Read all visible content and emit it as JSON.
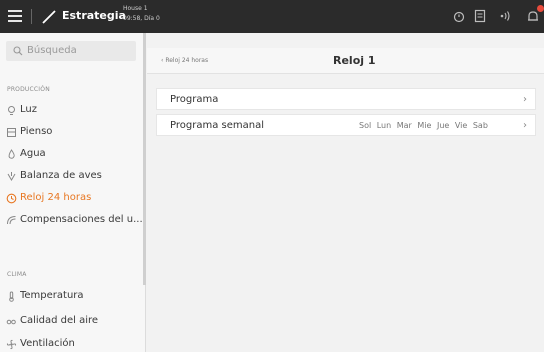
{
  "topbar": {
    "brand": "Estrategia",
    "house_name": "House 1",
    "house_time": "09:58, Día 0",
    "icons": [
      "menu-icon",
      "chart-icon",
      "alarm-icon",
      "document-icon",
      "broadcast-icon",
      "bell-icon"
    ]
  },
  "sidebar": {
    "search_placeholder": "Búsqueda",
    "sections": [
      {
        "label": "PRODUCCIÓN",
        "items": [
          {
            "label": "Luz",
            "icon": "bulb-icon"
          },
          {
            "label": "Pienso",
            "icon": "feed-icon"
          },
          {
            "label": "Agua",
            "icon": "drop-icon"
          },
          {
            "label": "Balanza de aves",
            "icon": "scale-icon"
          },
          {
            "label": "Reloj 24 horas",
            "icon": "clock-icon",
            "active": true
          },
          {
            "label": "Compensaciones del u...",
            "icon": "compensation-icon"
          }
        ]
      },
      {
        "label": "CLIMA",
        "items": [
          {
            "label": "Temperatura",
            "icon": "thermometer-icon"
          },
          {
            "label": "Calidad del aire",
            "icon": "air-icon"
          },
          {
            "label": "Ventilación",
            "icon": "fan-icon"
          }
        ]
      }
    ]
  },
  "main": {
    "back_label": "Reloj 24 horas",
    "title": "Reloj 1",
    "rows": [
      {
        "label": "Programa"
      },
      {
        "label": "Programa semanal",
        "days": "Sol Lun Mar Mie Jue Vie Sab"
      }
    ]
  },
  "colors": {
    "topbar": "#2b2b2b",
    "accent": "#e87722",
    "notification": "#e84b3c"
  }
}
